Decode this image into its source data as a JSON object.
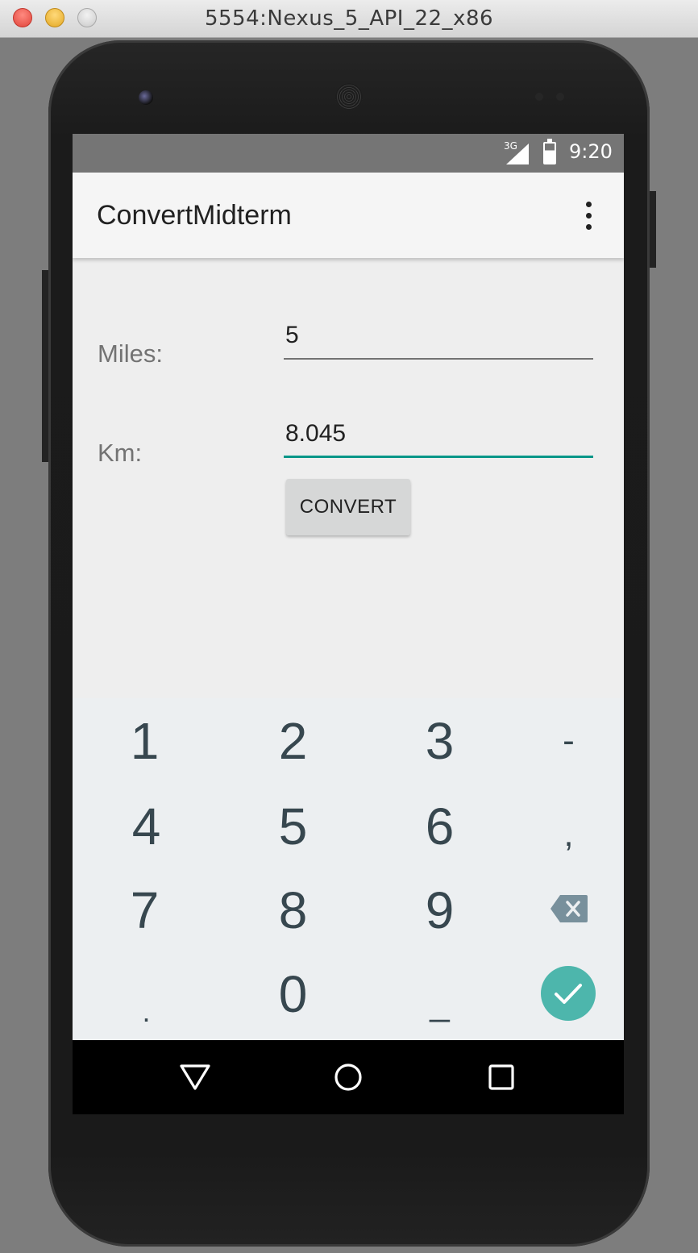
{
  "window": {
    "title": "5554:Nexus_5_API_22_x86"
  },
  "statusbar": {
    "network": "3G",
    "time": "9:20"
  },
  "appbar": {
    "title": "ConvertMidterm",
    "menu_icon": "more-vert-icon"
  },
  "form": {
    "miles_label": "Miles:",
    "miles_value": "5",
    "km_label": "Km:",
    "km_value": "8.045",
    "convert_label": "CONVERT"
  },
  "keyboard": {
    "keys": [
      "1",
      "2",
      "3",
      "-",
      "4",
      "5",
      "6",
      ",",
      "7",
      "8",
      "9",
      ".",
      "0",
      "_"
    ],
    "backspace_icon": "backspace-icon",
    "done_icon": "check-icon"
  },
  "navbar": {
    "back_icon": "back-triangle-icon",
    "home_icon": "home-circle-icon",
    "recents_icon": "recents-square-icon"
  },
  "colors": {
    "accent": "#009688",
    "done_button": "#4db6ac",
    "statusbar": "#757575"
  }
}
